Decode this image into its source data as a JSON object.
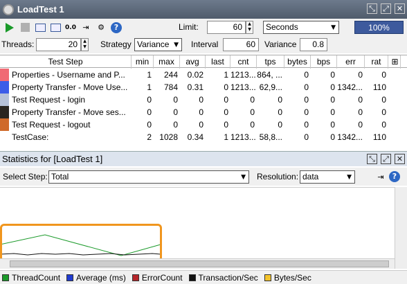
{
  "window": {
    "title": "LoadTest 1"
  },
  "toolbar": {
    "icons": [
      "run-icon",
      "stop-icon",
      "graph-icon",
      "statistics-history-icon",
      "reset-icon",
      "export-icon",
      "options-icon",
      "help-icon"
    ],
    "reset_label": "0.0",
    "limit_label": "Limit:",
    "limit_value": "60",
    "limit_unit": "Seconds",
    "progress": "100%"
  },
  "options": {
    "threads_label": "Threads:",
    "threads_value": "20",
    "strategy_label": "Strategy",
    "strategy_value": "Variance",
    "interval_label": "Interval",
    "interval_value": "60",
    "variance_label": "Variance",
    "variance_value": "0.8"
  },
  "table": {
    "columns": [
      "Test Step",
      "min",
      "max",
      "avg",
      "last",
      "cnt",
      "tps",
      "bytes",
      "bps",
      "err",
      "rat"
    ],
    "rows": [
      {
        "color": "#f06a74",
        "name": "Properties - Username and P...",
        "min": "1",
        "max": "244",
        "avg": "0.02",
        "last": "1",
        "cnt": "1213...",
        "tps": "864, ...",
        "bytes": "0",
        "bps": "0",
        "err": "0",
        "rat": "0"
      },
      {
        "color": "#3b5ce8",
        "name": "Property Transfer - Move Use...",
        "min": "1",
        "max": "784",
        "avg": "0.31",
        "last": "0",
        "cnt": "1213...",
        "tps": "62,9...",
        "bytes": "0",
        "bps": "0",
        "err": "1342...",
        "rat": "110"
      },
      {
        "color": "#b6c2d8",
        "name": "Test Request - login",
        "min": "0",
        "max": "0",
        "avg": "0",
        "last": "0",
        "cnt": "0",
        "tps": "0",
        "bytes": "0",
        "bps": "0",
        "err": "0",
        "rat": "0"
      },
      {
        "color": "#2a2620",
        "name": "Property Transfer - Move ses...",
        "min": "0",
        "max": "0",
        "avg": "0",
        "last": "0",
        "cnt": "0",
        "tps": "0",
        "bytes": "0",
        "bps": "0",
        "err": "0",
        "rat": "0"
      },
      {
        "color": "#cf6a2a",
        "name": "Test Request - logout",
        "min": "0",
        "max": "0",
        "avg": "0",
        "last": "0",
        "cnt": "0",
        "tps": "0",
        "bytes": "0",
        "bps": "0",
        "err": "0",
        "rat": "0"
      },
      {
        "color": "#ffffff",
        "name": "TestCase:",
        "min": "2",
        "max": "1028",
        "avg": "0.34",
        "last": "1",
        "cnt": "1213...",
        "tps": "58,8...",
        "bytes": "0",
        "bps": "0",
        "err": "1342...",
        "rat": "110"
      }
    ]
  },
  "stats": {
    "title": "Statistics for [LoadTest 1]",
    "select_step_label": "Select Step:",
    "select_step_value": "Total",
    "resolution_label": "Resolution:",
    "resolution_value": "data"
  },
  "legend": [
    {
      "label": "ThreadCount",
      "color": "#1b9a2a"
    },
    {
      "label": "Average (ms)",
      "color": "#1f3bd0"
    },
    {
      "label": "ErrorCount",
      "color": "#b5262a"
    },
    {
      "label": "Transaction/Sec",
      "color": "#111111"
    },
    {
      "label": "Bytes/Sec",
      "color": "#f3c32a"
    }
  ],
  "accent": {
    "progress_fill": "#3d5a9d",
    "highlight": "#f0961e"
  }
}
